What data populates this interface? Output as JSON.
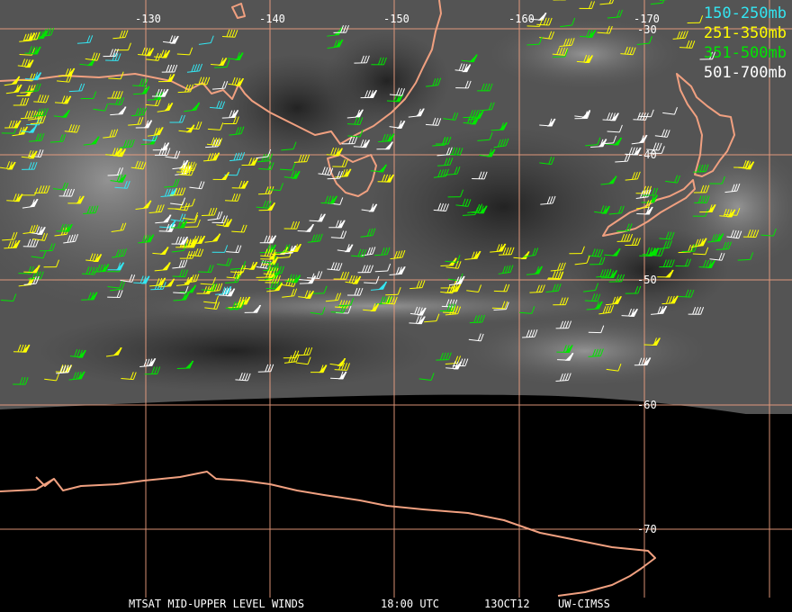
{
  "title": "MTSAT MID-UPPER LEVEL WINDS",
  "time": "18:00 UTC",
  "date": "13OCT12",
  "credit": "UW-CIMSS",
  "legend": [
    {
      "label": "150-250mb",
      "color": "#33e6f2"
    },
    {
      "label": "251-350mb",
      "color": "#ffff00"
    },
    {
      "label": "351-500mb",
      "color": "#00e600"
    },
    {
      "label": "501-700mb",
      "color": "#ffffff"
    }
  ],
  "longitude_labels": [
    "-130",
    "-140",
    "-150",
    "-160",
    "-170"
  ],
  "latitude_labels": [
    "-30",
    "-40",
    "-50",
    "-60",
    "-70"
  ],
  "colors": {
    "coast": "#f0a080",
    "grid": "#f0a080",
    "ocean": "#505050",
    "space": "#000000"
  }
}
